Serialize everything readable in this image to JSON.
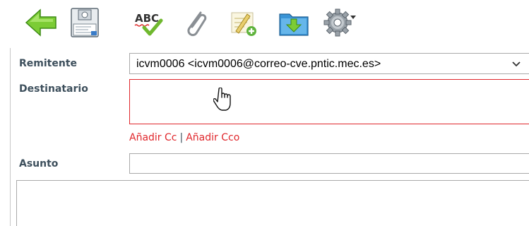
{
  "toolbar": {
    "buttons": [
      {
        "name": "back-button",
        "icon": "arrow-left-icon"
      },
      {
        "name": "save-button",
        "icon": "save-icon"
      },
      {
        "name": "spellcheck-button",
        "icon": "spellcheck-icon",
        "label": "ABC"
      },
      {
        "name": "attach-button",
        "icon": "paperclip-icon"
      },
      {
        "name": "signature-button",
        "icon": "signature-icon"
      },
      {
        "name": "save-to-folder-button",
        "icon": "folder-download-icon"
      },
      {
        "name": "options-button",
        "icon": "gear-icon"
      }
    ]
  },
  "form": {
    "from_label": "Remitente",
    "from_value": "icvm0006 <icvm0006@correo-cve.pntic.mec.es>",
    "to_label": "Destinatario",
    "to_value": "",
    "add_cc": "Añadir Cc",
    "separator": "|",
    "add_bcc": "Añadir Cco",
    "subject_label": "Asunto",
    "subject_value": "",
    "body_value": ""
  },
  "colors": {
    "label": "#3d4f5c",
    "accent_red": "#e0262b",
    "border": "#a9a9a9"
  }
}
